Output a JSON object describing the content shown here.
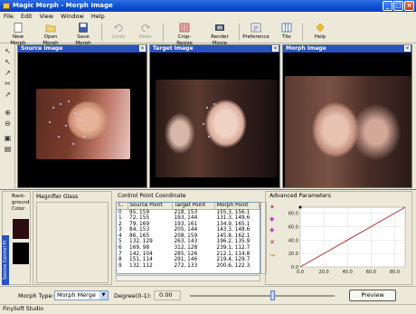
{
  "window": {
    "title": "Magic Morph - Morph Image",
    "min": "_",
    "max": "□",
    "close": "×"
  },
  "menu": [
    "File",
    "Edit",
    "View",
    "Window",
    "Help"
  ],
  "toolbar": {
    "new_morph": "New Morph",
    "open_morph": "Open Morph",
    "save_morph": "Save Morph",
    "undo": "Undo",
    "redo": "Redo",
    "crop_resize": "Crop-Resize",
    "render_movie": "Render Movie",
    "preference": "Preference",
    "tile": "Tile",
    "help": "Help"
  },
  "panels": {
    "source": "Source Image",
    "target": "Target Image",
    "morph": "Morph Image",
    "close": "×"
  },
  "bottom": {
    "bg_color_label": "Back-ground Color",
    "magnifier_label": "Magnifier Glass",
    "cpc_label": "Control Point Coordinate",
    "adv_label": "Advanced Parameters",
    "vertical_tab": "Source Control Pt"
  },
  "table": {
    "headers": [
      "I..",
      "Source Point",
      "Target Point",
      "Morph Point"
    ],
    "rows": [
      [
        "0",
        "95, 159",
        "218, 153",
        "155.3, 156.1"
      ],
      [
        "1",
        "72, 155",
        "193, 144",
        "131.3, 149.6"
      ],
      [
        "2",
        "79, 169",
        "193, 161",
        "134.9, 165.1"
      ],
      [
        "3",
        "84, 153",
        "205, 144",
        "143.3, 148.6"
      ],
      [
        "4",
        "86, 165",
        "208, 159",
        "145.8, 162.1"
      ],
      [
        "5",
        "132, 129",
        "263, 143",
        "196.2, 135.9"
      ],
      [
        "6",
        "169, 98",
        "312, 128",
        "239.1, 112.7"
      ],
      [
        "7",
        "142, 104",
        "285, 126",
        "212.1, 114.8"
      ],
      [
        "8",
        "151, 114",
        "291, 146",
        "219.4, 129.7"
      ],
      [
        "9",
        "132, 112",
        "272, 133",
        "200.6, 122.3"
      ]
    ]
  },
  "chart": {
    "x_ticks": [
      "0.0",
      "20.0",
      "40.0",
      "60.0",
      "80.0"
    ],
    "y_ticks": [
      "0.0",
      "20.0",
      "40.0",
      "60.0",
      "80.0"
    ]
  },
  "controls": {
    "morph_type_label": "Morph Type:",
    "morph_type_value": "Morph Merge",
    "degree_label": "Degree(0-1):",
    "degree_value": "0.00",
    "preview": "Preview",
    "slider_level": 0.57
  },
  "status": {
    "company": "FinySoft Studio"
  }
}
